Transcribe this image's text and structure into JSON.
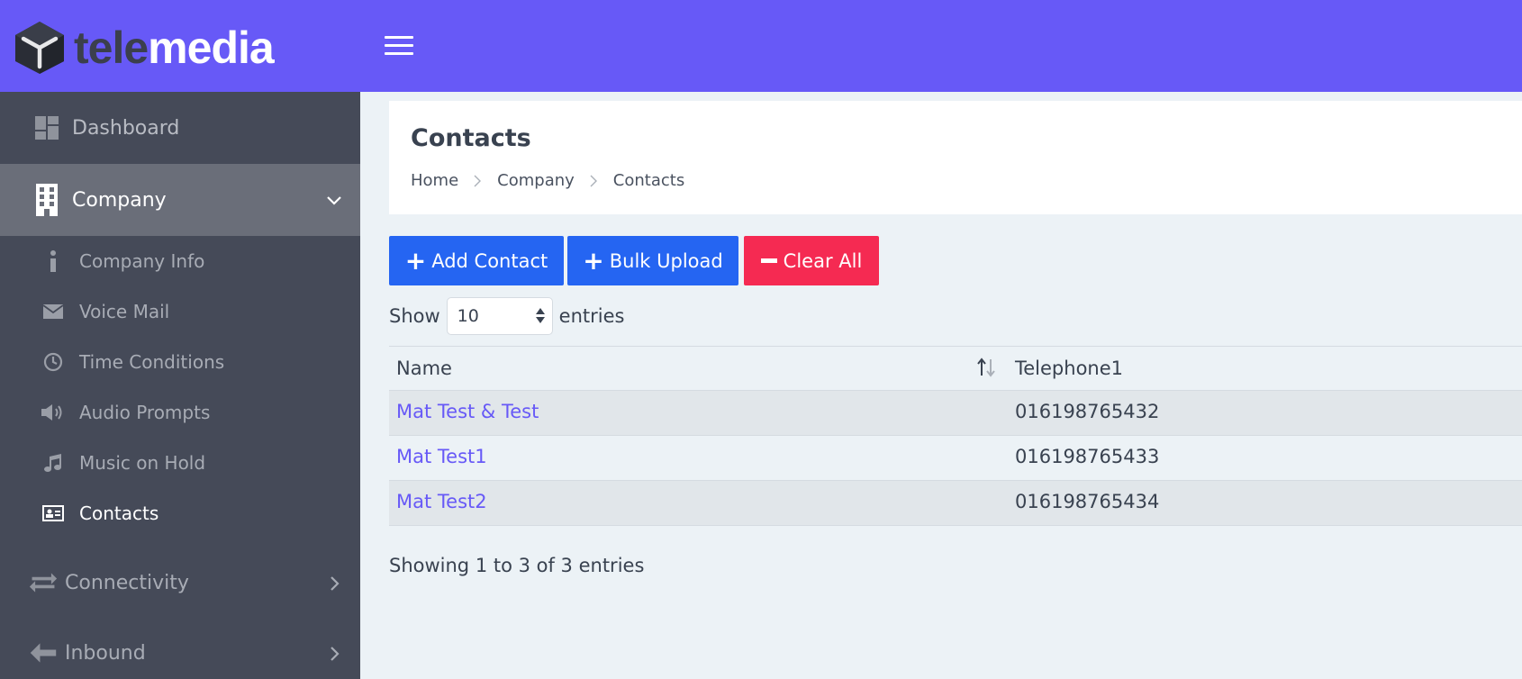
{
  "brand": {
    "logo_tele": "tele",
    "logo_media": "media"
  },
  "sidebar": {
    "dashboard": "Dashboard",
    "company": "Company",
    "company_items": [
      {
        "label": "Company Info",
        "icon": "info-icon"
      },
      {
        "label": "Voice Mail",
        "icon": "envelope-icon"
      },
      {
        "label": "Time Conditions",
        "icon": "clock-icon"
      },
      {
        "label": "Audio Prompts",
        "icon": "speaker-icon"
      },
      {
        "label": "Music on Hold",
        "icon": "music-note-icon"
      },
      {
        "label": "Contacts",
        "icon": "contact-card-icon",
        "active": true
      }
    ],
    "connectivity": "Connectivity",
    "inbound": "Inbound"
  },
  "page": {
    "title": "Contacts",
    "breadcrumb": [
      "Home",
      "Company",
      "Contacts"
    ]
  },
  "toolbar": {
    "add_label": "Add Contact",
    "bulk_label": "Bulk Upload",
    "clear_label": "Clear All"
  },
  "length": {
    "show": "Show",
    "value": "10",
    "entries": "entries"
  },
  "table": {
    "headers": {
      "name": "Name",
      "telephone": "Telephone1"
    },
    "rows": [
      {
        "name": "Mat Test & Test",
        "telephone": "016198765432"
      },
      {
        "name": "Mat Test1",
        "telephone": "016198765433"
      },
      {
        "name": "Mat Test2",
        "telephone": "016198765434"
      }
    ],
    "info": "Showing 1 to 3 of 3 entries"
  },
  "colors": {
    "topbar": "#6759f7",
    "sidebar": "#454a58",
    "sidebar_active": "#6a6e79",
    "primary_button": "#2565f2",
    "danger_button": "#f52a52",
    "link": "#6759f7"
  }
}
